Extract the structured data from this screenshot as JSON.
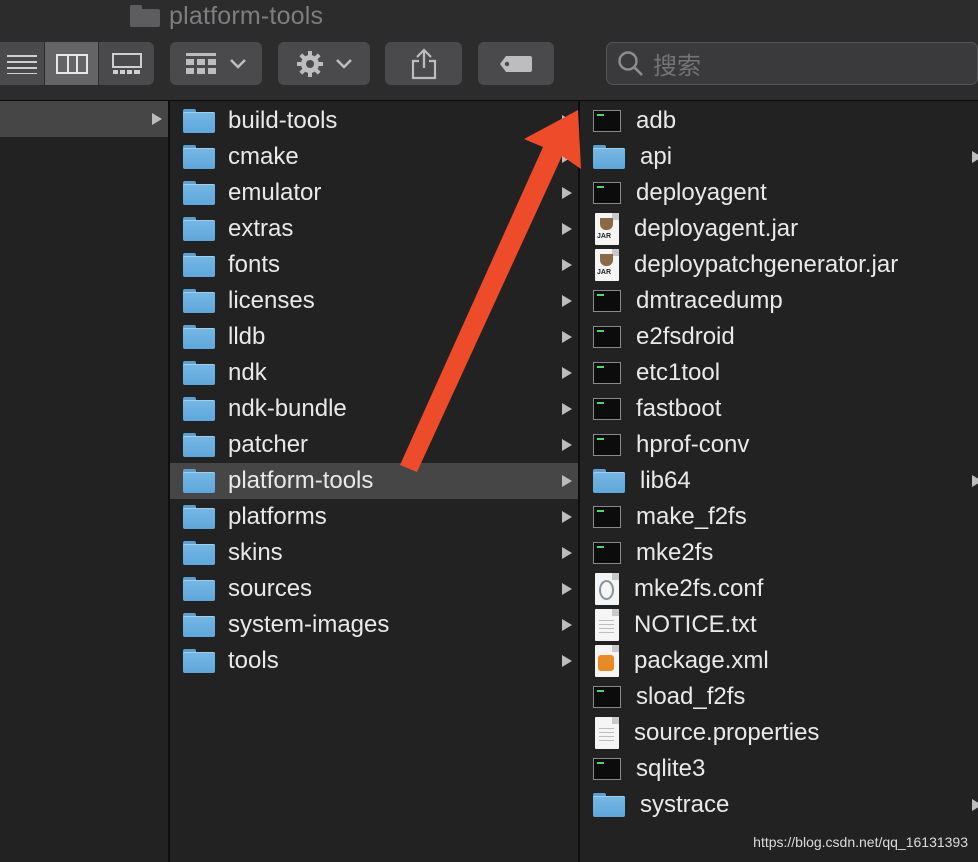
{
  "window": {
    "title": "platform-tools"
  },
  "toolbar": {
    "search_placeholder": "搜索"
  },
  "column1": {
    "selected_row_has_chevron": true
  },
  "column2": {
    "items": [
      {
        "label": "build-tools",
        "type": "folder"
      },
      {
        "label": "cmake",
        "type": "folder"
      },
      {
        "label": "emulator",
        "type": "folder"
      },
      {
        "label": "extras",
        "type": "folder"
      },
      {
        "label": "fonts",
        "type": "folder"
      },
      {
        "label": "licenses",
        "type": "folder"
      },
      {
        "label": "lldb",
        "type": "folder"
      },
      {
        "label": "ndk",
        "type": "folder"
      },
      {
        "label": "ndk-bundle",
        "type": "folder"
      },
      {
        "label": "patcher",
        "type": "folder"
      },
      {
        "label": "platform-tools",
        "type": "folder",
        "selected": true
      },
      {
        "label": "platforms",
        "type": "folder"
      },
      {
        "label": "skins",
        "type": "folder"
      },
      {
        "label": "sources",
        "type": "folder"
      },
      {
        "label": "system-images",
        "type": "folder"
      },
      {
        "label": "tools",
        "type": "folder"
      }
    ]
  },
  "column3": {
    "items": [
      {
        "label": "adb",
        "type": "exec"
      },
      {
        "label": "api",
        "type": "folder"
      },
      {
        "label": "deployagent",
        "type": "exec"
      },
      {
        "label": "deployagent.jar",
        "type": "jar"
      },
      {
        "label": "deploypatchgenerator.jar",
        "type": "jar"
      },
      {
        "label": "dmtracedump",
        "type": "exec"
      },
      {
        "label": "e2fsdroid",
        "type": "exec"
      },
      {
        "label": "etc1tool",
        "type": "exec"
      },
      {
        "label": "fastboot",
        "type": "exec"
      },
      {
        "label": "hprof-conv",
        "type": "exec"
      },
      {
        "label": "lib64",
        "type": "folder"
      },
      {
        "label": "make_f2fs",
        "type": "exec"
      },
      {
        "label": "mke2fs",
        "type": "exec"
      },
      {
        "label": "mke2fs.conf",
        "type": "conf"
      },
      {
        "label": "NOTICE.txt",
        "type": "text"
      },
      {
        "label": "package.xml",
        "type": "xml"
      },
      {
        "label": "sload_f2fs",
        "type": "exec"
      },
      {
        "label": "source.properties",
        "type": "text"
      },
      {
        "label": "sqlite3",
        "type": "exec"
      },
      {
        "label": "systrace",
        "type": "folder"
      }
    ]
  },
  "annotation": {
    "arrow_color": "#ee4b2b"
  },
  "watermark": "https://blog.csdn.net/qq_16131393"
}
